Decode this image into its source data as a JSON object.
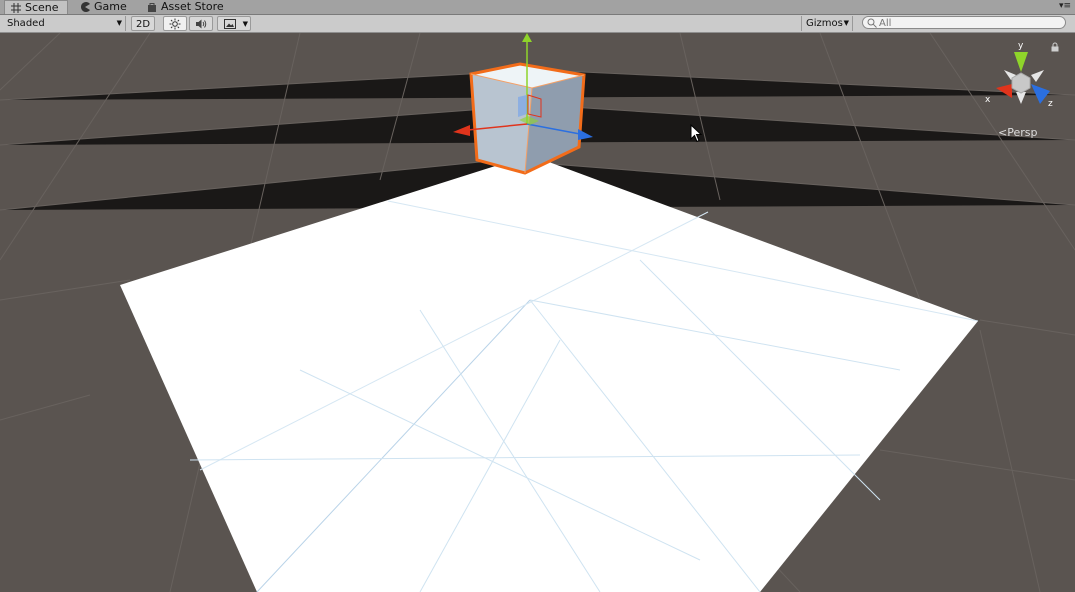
{
  "tabs": [
    {
      "label": "Scene",
      "icon": "grid-icon",
      "active": true
    },
    {
      "label": "Game",
      "icon": "pacman-icon",
      "active": false
    },
    {
      "label": "Asset Store",
      "icon": "shopping-bag-icon",
      "active": false
    }
  ],
  "toolbar": {
    "draw_mode": "Shaded",
    "mode_2d": "2D",
    "lighting_icon": "sun-icon",
    "audio_icon": "speaker-icon",
    "effects_icon": "image-icon",
    "gizmos": "Gizmos",
    "search_placeholder": "All"
  },
  "scene": {
    "projection_label": "Persp",
    "axes": {
      "x": "x",
      "y": "y",
      "z": "z"
    },
    "colors": {
      "background": "#5a5450",
      "plane": "#ffffff",
      "selection_outline": "#f26c1a",
      "x_axis": "#e0341c",
      "y_axis": "#8fd42a",
      "z_axis": "#2b6fe0"
    }
  }
}
